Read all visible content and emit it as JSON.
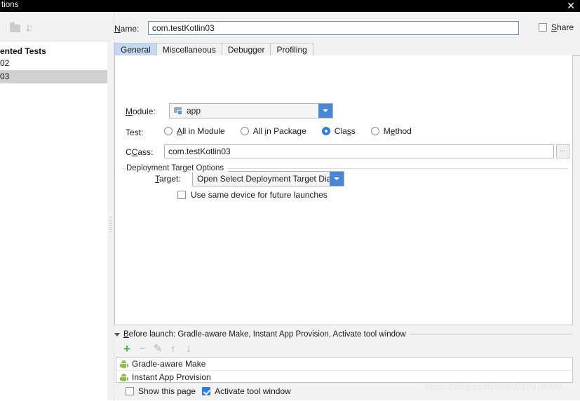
{
  "window": {
    "title": "tions",
    "close_icon": "✕"
  },
  "sidebar": {
    "toolbar": [
      {
        "name": "folder-icon",
        "label": ""
      },
      {
        "name": "sort-alphabetically-icon",
        "label": "↓"
      }
    ],
    "group_label": "ented Tests",
    "items": [
      {
        "label": "02",
        "selected": false
      },
      {
        "label": "03",
        "selected": true
      }
    ]
  },
  "form": {
    "name_label": "Name:",
    "name_mnemonic": "N",
    "name_value": "com.testKotlin03",
    "name_placeholder": "",
    "share_label": "Share",
    "share_mnemonic": "S",
    "share_checked": false
  },
  "tabs": [
    {
      "label": "General",
      "active": true
    },
    {
      "label": "Miscellaneous",
      "active": false
    },
    {
      "label": "Debugger",
      "active": false
    },
    {
      "label": "Profiling",
      "active": false
    }
  ],
  "general": {
    "module_label": "Module:",
    "module_mnemonic": "M",
    "module_value": "app",
    "test_label": "Test:",
    "test_options": [
      {
        "label": "All in Module",
        "selected": false
      },
      {
        "label": "All in Package",
        "selected": false
      },
      {
        "label": "Class",
        "selected": true
      },
      {
        "label": "Method",
        "selected": false
      }
    ],
    "class_label": "Class:",
    "class_mnemonic": "C",
    "class_value": "com.testKotlin03",
    "browse_label": "...",
    "deployment_group_title": "Deployment Target Options",
    "target_label": "Target:",
    "target_mnemonic": "T",
    "target_value": "Open Select Deployment Target Dialog",
    "same_device_label": "Use same device for future launches",
    "same_device_checked": false
  },
  "before_launch": {
    "header": "Before launch: Gradle-aware Make, Instant App Provision, Activate tool window",
    "header_mnemonic": "B",
    "toolbar": [
      {
        "name": "add-task-button",
        "glyph": "+"
      },
      {
        "name": "remove-task-button",
        "glyph": "−"
      },
      {
        "name": "edit-task-button",
        "glyph": "✎"
      },
      {
        "name": "move-up-button",
        "glyph": "↑"
      },
      {
        "name": "move-down-button",
        "glyph": "↓"
      }
    ],
    "tasks": [
      {
        "label": "Gradle-aware Make",
        "icon": "android-icon"
      },
      {
        "label": "Instant App Provision",
        "icon": "android-icon"
      }
    ]
  },
  "footer": {
    "show_page_label": "Show this page",
    "show_page_checked": false,
    "activate_tool_window_label": "Activate tool window",
    "activate_tool_window_checked": true
  },
  "watermark": {
    "text": "https://blog.csdn.net/u010979599"
  },
  "colors": {
    "accent": "#2a7fe0",
    "combo_arrow": "#4a86d8",
    "tab_active": "#c4d8f0",
    "android_green": "#8cc04d",
    "title_bar": "#000000",
    "panel_bg": "#f2f2f2"
  }
}
